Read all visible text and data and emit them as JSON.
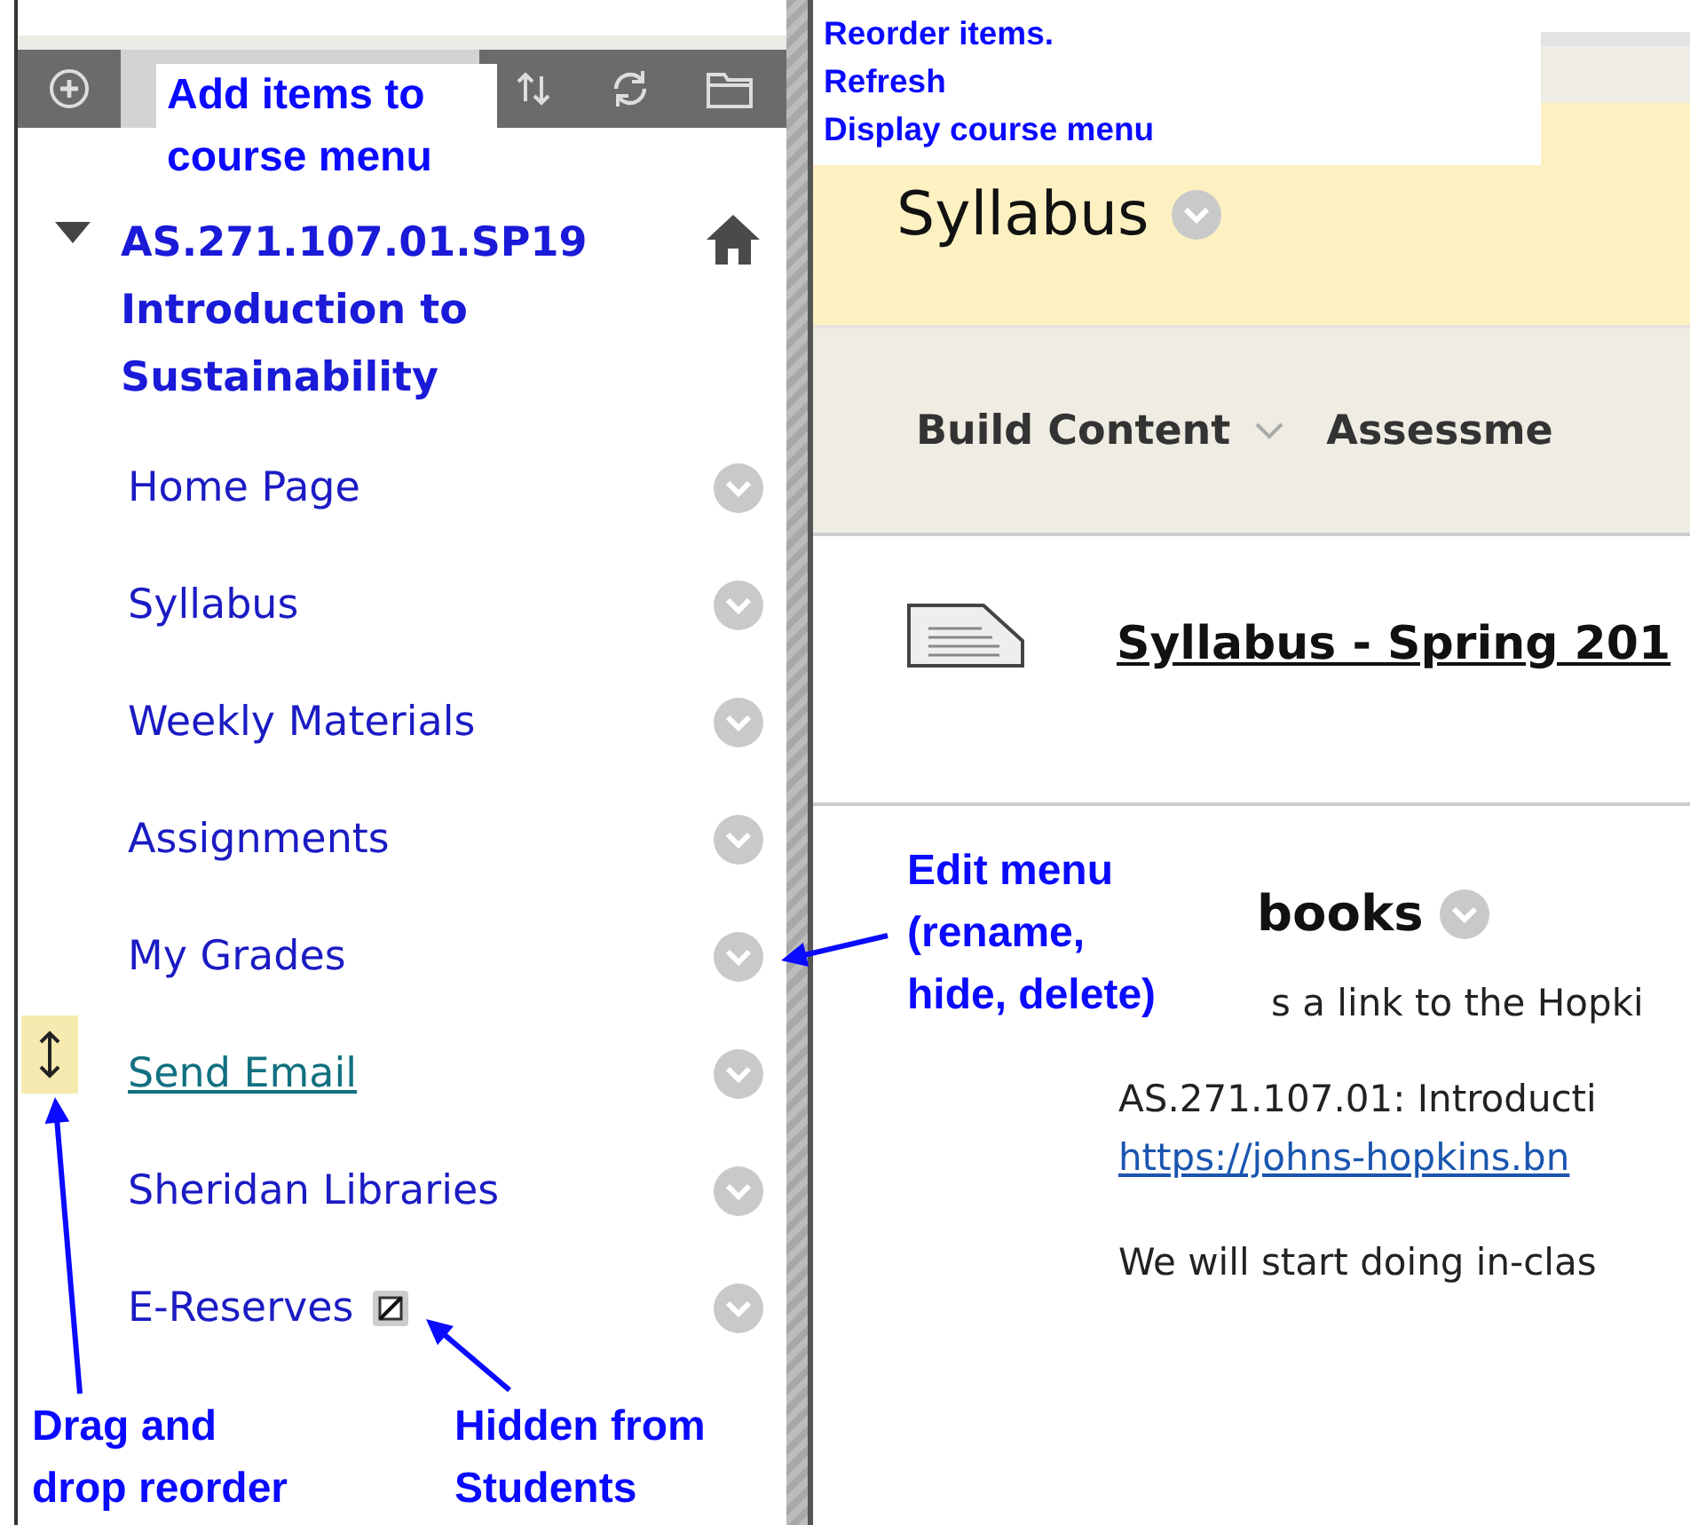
{
  "course_menu": {
    "course_title": "AS.271.107.01.SP19 Introduction to Sustainability",
    "expanded": true,
    "items": [
      {
        "label": "Home Page",
        "hovered": false,
        "hidden": false
      },
      {
        "label": "Syllabus",
        "hovered": false,
        "hidden": false
      },
      {
        "label": "Weekly Materials",
        "hovered": false,
        "hidden": false
      },
      {
        "label": "Assignments",
        "hovered": false,
        "hidden": false
      },
      {
        "label": "My Grades",
        "hovered": false,
        "hidden": false
      },
      {
        "label": "Send Email",
        "hovered": true,
        "hidden": false
      },
      {
        "label": "Sheridan Libraries",
        "hovered": false,
        "hidden": false
      },
      {
        "label": "E-Reserves",
        "hovered": false,
        "hidden": true
      }
    ]
  },
  "page": {
    "title": "Syllabus",
    "action_bar": [
      "Build Content",
      "Assessme"
    ],
    "content_item": {
      "title": "Syllabus - Spring 201"
    },
    "section": {
      "title": "books",
      "paragraphs": [
        "s a link to the Hopki",
        "AS.271.107.01: Introducti",
        "We will start doing in-clas"
      ],
      "link": "https://johns-hopkins.bn"
    }
  },
  "annotations": [
    {
      "text": "Add items to\ncourse menu"
    },
    {
      "text": "Reorder items.\nRefresh\nDisplay course menu"
    },
    {
      "text": "Edit menu\n(rename,\nhide, delete)",
      "arrow": true
    },
    {
      "text": "Drag and\ndrop reorder",
      "arrow": true
    },
    {
      "text": "Hidden from\nStudents",
      "arrow": true
    }
  ]
}
